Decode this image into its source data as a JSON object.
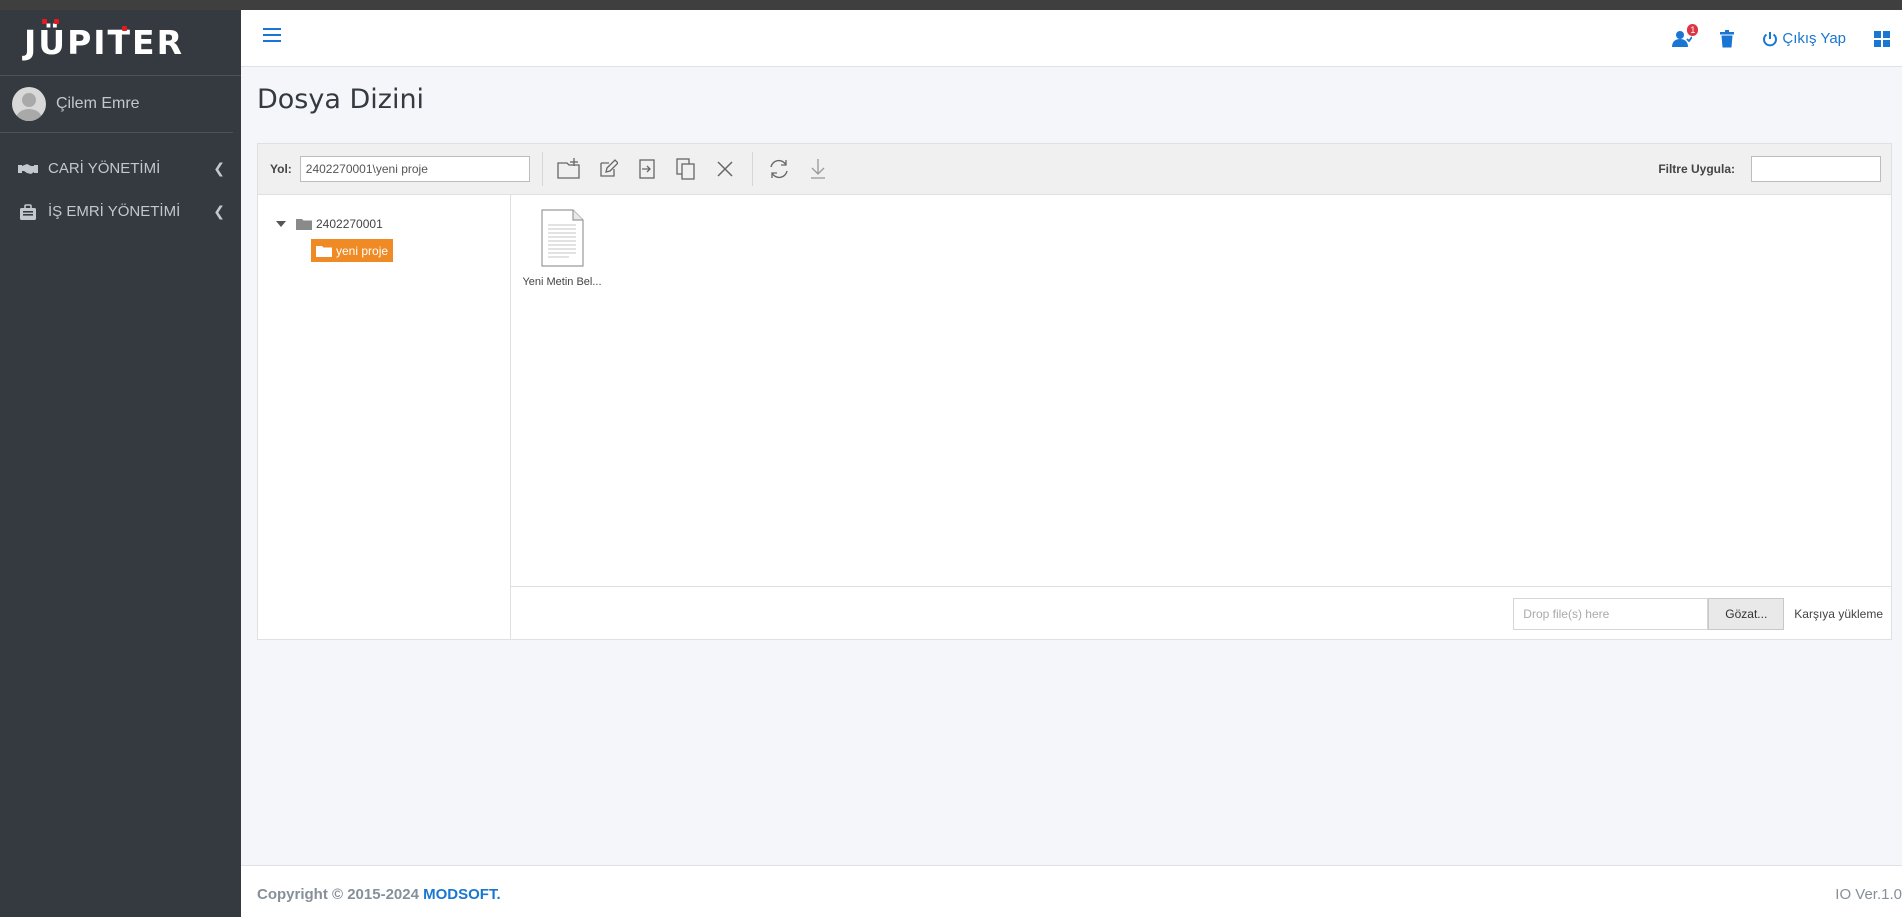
{
  "app": {
    "brand": "JÜPITER"
  },
  "user": {
    "name": "Çilem Emre"
  },
  "sidebar": {
    "items": [
      {
        "label": "CARİ YÖNETİMİ",
        "icon": "handshake-icon"
      },
      {
        "label": "İŞ EMRİ YÖNETİMİ",
        "icon": "briefcase-icon"
      }
    ]
  },
  "header": {
    "notification_count": "1",
    "logout_label": "Çıkış Yap"
  },
  "page": {
    "title": "Dosya Dizini"
  },
  "file_manager": {
    "path_label": "Yol:",
    "path_value": "2402270001\\yeni proje",
    "filter_label": "Filtre Uygula:",
    "filter_value": "",
    "tree": {
      "root": "2402270001",
      "children": [
        {
          "label": "yeni proje",
          "selected": true
        }
      ]
    },
    "files": [
      {
        "name": "Yeni Metin Bel..."
      }
    ],
    "upload": {
      "placeholder": "Drop file(s) here",
      "browse_label": "Gözat...",
      "upload_label": "Karşıya yükleme"
    }
  },
  "footer": {
    "copyright_prefix": "Copyright © 2015-2024 ",
    "company": "MODSOFT.",
    "version": "IO Ver.1.0"
  },
  "colors": {
    "sidebar_bg": "#343a40",
    "accent": "#1976d2",
    "selected_folder": "#f08a24",
    "brand_dot": "#e21b23"
  }
}
